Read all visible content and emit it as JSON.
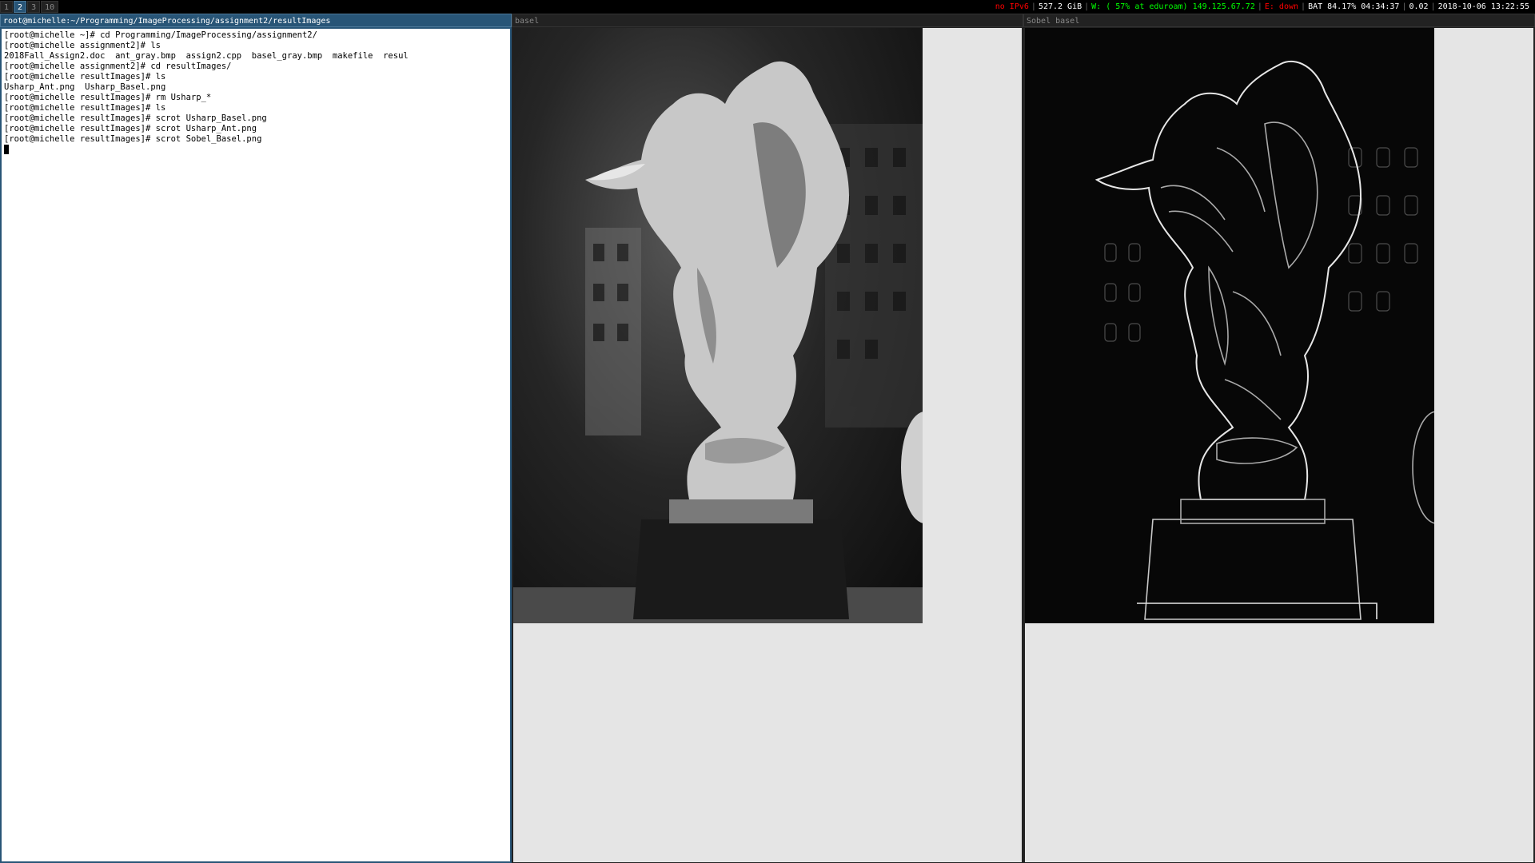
{
  "bar": {
    "workspaces": [
      {
        "label": "1",
        "active": false
      },
      {
        "label": "2",
        "active": true
      },
      {
        "label": "3",
        "active": false
      },
      {
        "label": "10",
        "active": false
      }
    ],
    "status": [
      {
        "text": "no IPv6",
        "color": "#ff0000"
      },
      {
        "text": "527.2 GiB",
        "color": "#ffffff"
      },
      {
        "text": "W: ( 57% at eduroam) 149.125.67.72",
        "color": "#00ff00"
      },
      {
        "text": "E: down",
        "color": "#ff0000"
      },
      {
        "text": "BAT 84.17% 04:34:37",
        "color": "#ffffff"
      },
      {
        "text": "0.02",
        "color": "#ffffff"
      },
      {
        "text": "2018-10-06 13:22:55",
        "color": "#ffffff"
      }
    ]
  },
  "terminal": {
    "title": "root@michelle:~/Programming/ImageProcessing/assignment2/resultImages",
    "lines": [
      "[root@michelle ~]# cd Programming/ImageProcessing/assignment2/",
      "[root@michelle assignment2]# ls",
      "2018Fall_Assign2.doc  ant_gray.bmp  assign2.cpp  basel_gray.bmp  makefile  resul",
      "[root@michelle assignment2]# cd resultImages/",
      "[root@michelle resultImages]# ls",
      "Usharp_Ant.png  Usharp_Basel.png",
      "[root@michelle resultImages]# rm Usharp_*",
      "[root@michelle resultImages]# ls",
      "[root@michelle resultImages]# scrot Usharp_Basel.png",
      "[root@michelle resultImages]# scrot Usharp_Ant.png",
      "[root@michelle resultImages]# scrot Sobel_Basel.png"
    ]
  },
  "image_windows": {
    "left_title": "basel",
    "right_title": "Sobel basel"
  },
  "colors": {
    "focused_title": "#285577",
    "unfocused_title": "#222222",
    "viewer_background": "#e5e5e5"
  }
}
